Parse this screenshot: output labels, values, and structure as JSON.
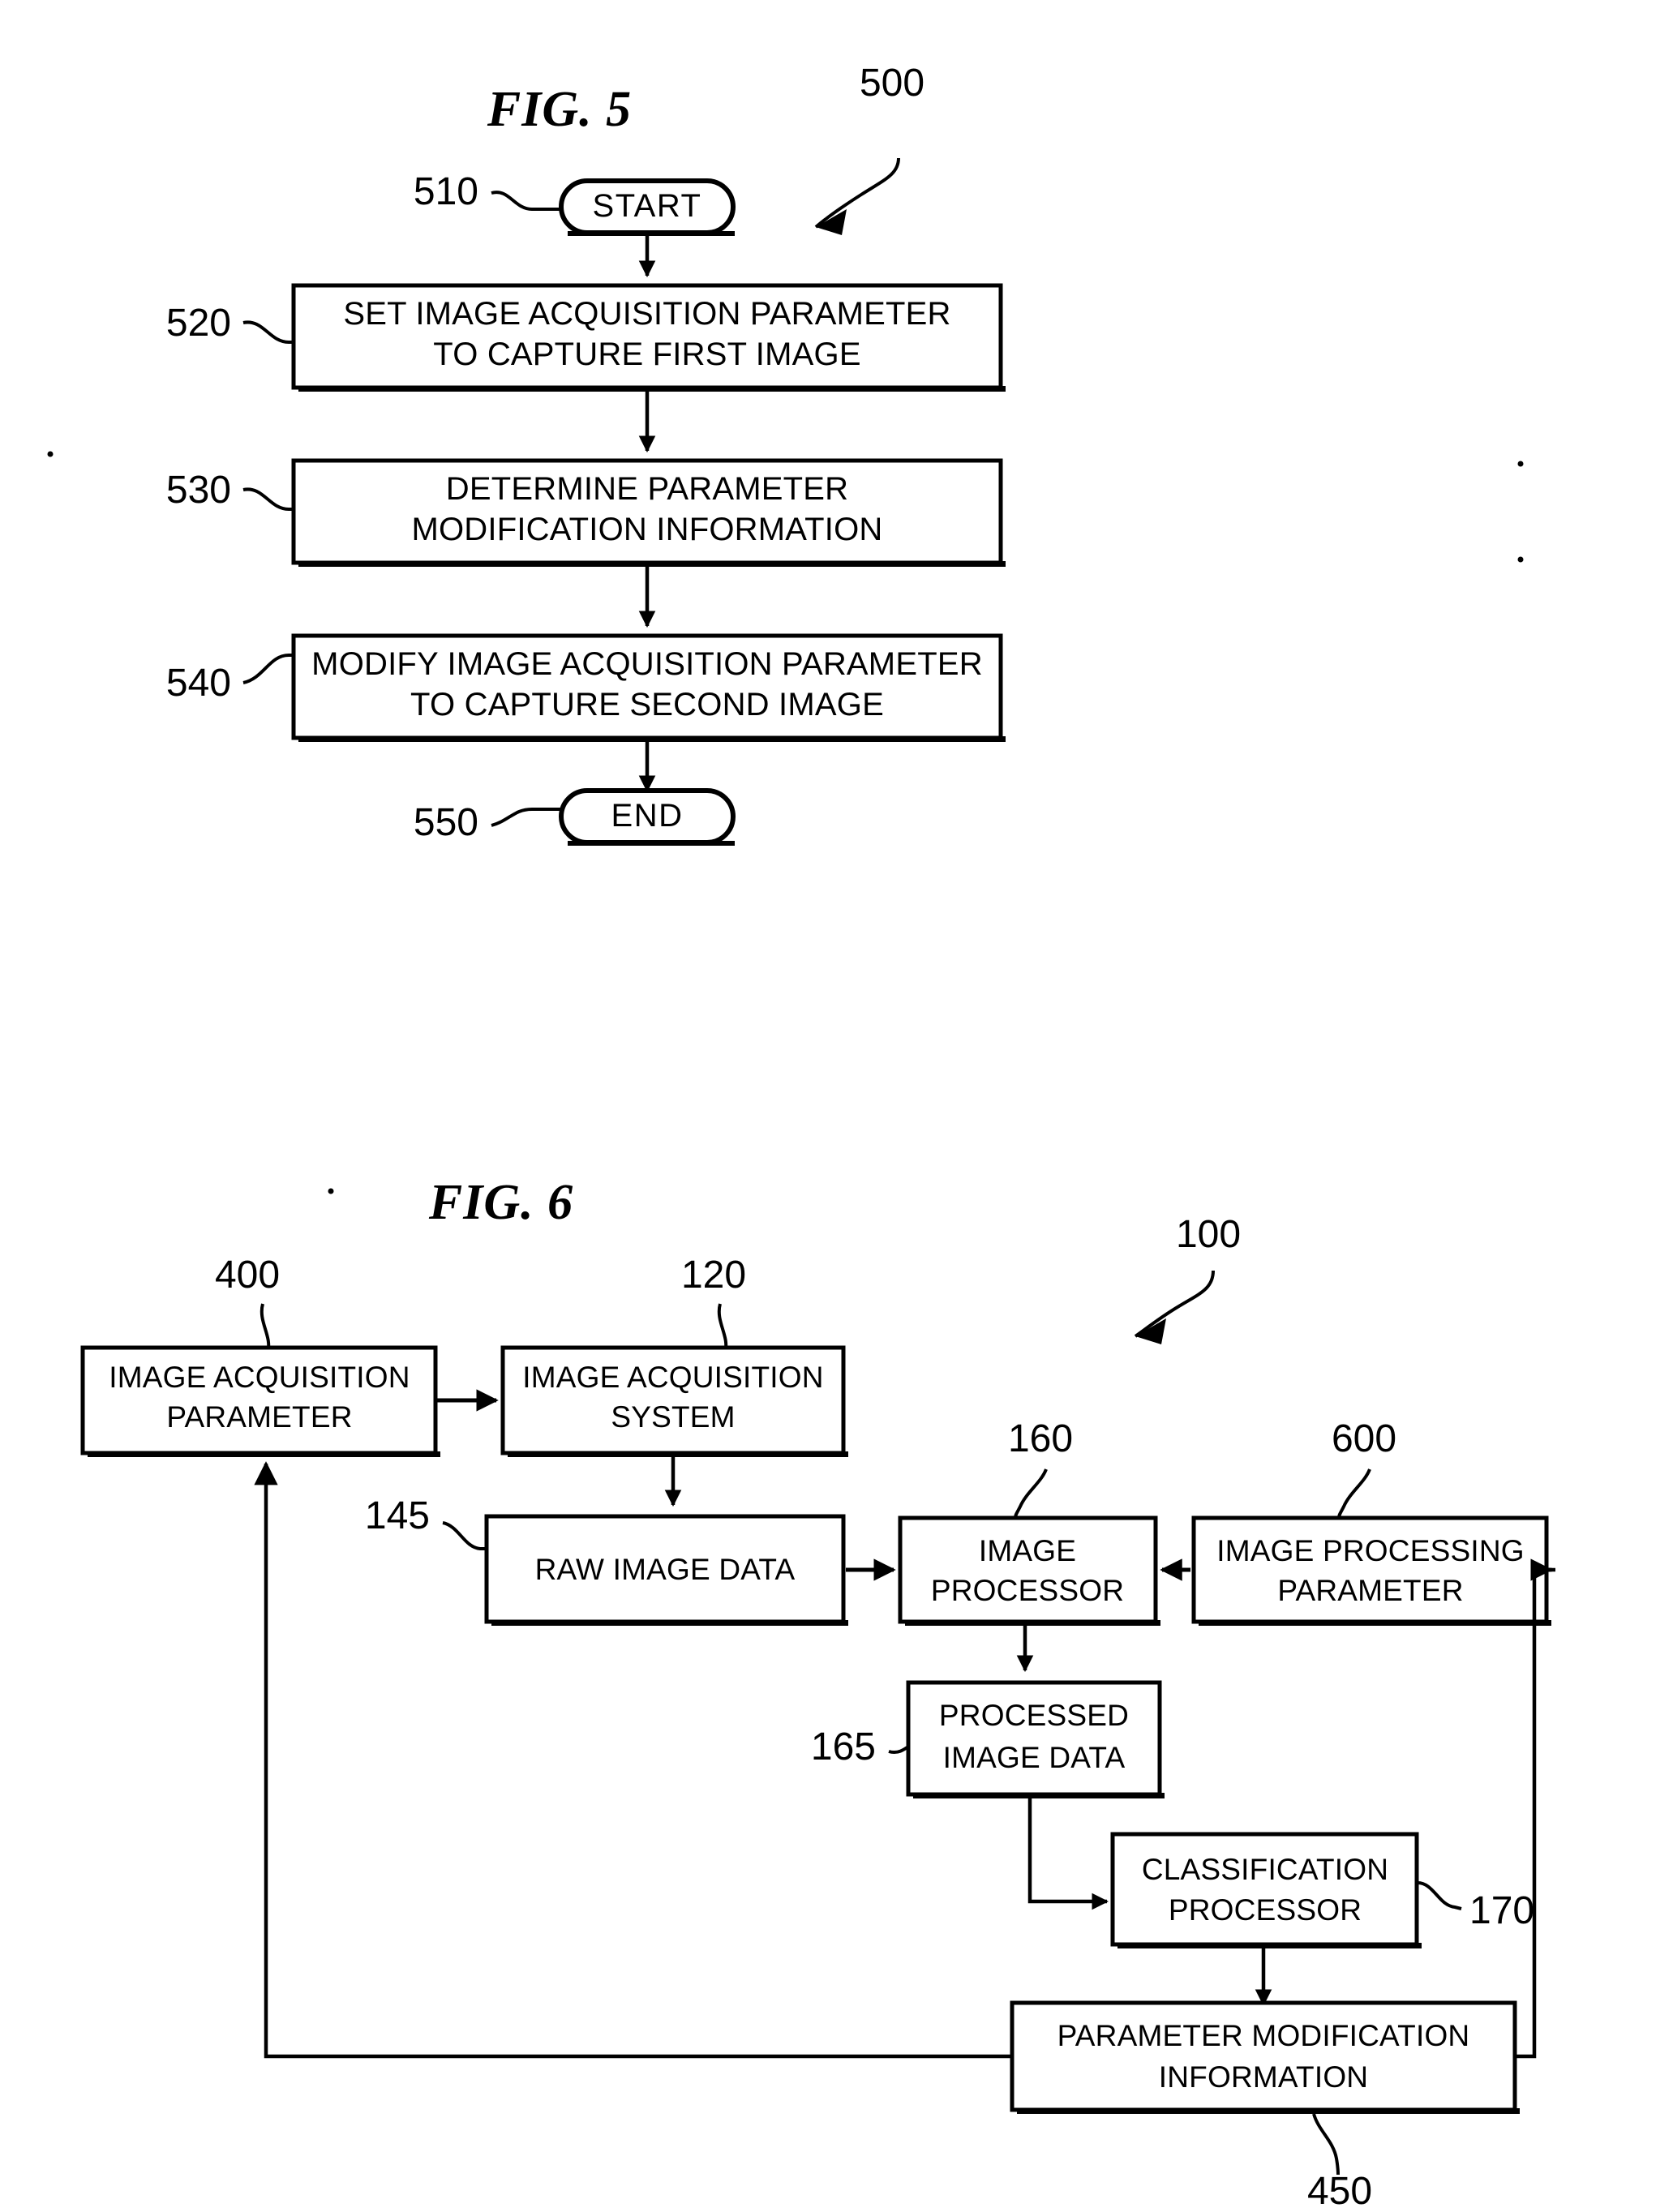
{
  "figure5": {
    "title": "FIG. 5",
    "diagram_ref": "500",
    "nodes": {
      "start": {
        "ref": "510",
        "label": "START"
      },
      "step_520": {
        "ref": "520",
        "line1": "SET IMAGE ACQUISITION PARAMETER",
        "line2": "TO CAPTURE FIRST IMAGE"
      },
      "step_530": {
        "ref": "530",
        "line1": "DETERMINE PARAMETER",
        "line2": "MODIFICATION INFORMATION"
      },
      "step_540": {
        "ref": "540",
        "line1": "MODIFY IMAGE ACQUISITION PARAMETER",
        "line2": "TO CAPTURE SECOND IMAGE"
      },
      "end": {
        "ref": "550",
        "label": "END"
      }
    }
  },
  "figure6": {
    "title": "FIG. 6",
    "diagram_ref": "100",
    "nodes": {
      "acq_param": {
        "ref": "400",
        "line1": "IMAGE ACQUISITION",
        "line2": "PARAMETER"
      },
      "acq_system": {
        "ref": "120",
        "line1": "IMAGE ACQUISITION",
        "line2": "SYSTEM"
      },
      "raw_data": {
        "ref": "145",
        "line1": "RAW IMAGE DATA",
        "line2": ""
      },
      "image_processor": {
        "ref": "160",
        "line1": "IMAGE",
        "line2": "PROCESSOR"
      },
      "processing_param": {
        "ref": "600",
        "line1": "IMAGE PROCESSING",
        "line2": "PARAMETER"
      },
      "processed_data": {
        "ref": "165",
        "line1": "PROCESSED",
        "line2": "IMAGE DATA"
      },
      "classification": {
        "ref": "170",
        "line1": "CLASSIFICATION",
        "line2": "PROCESSOR"
      },
      "param_mod_info": {
        "ref": "450",
        "line1": "PARAMETER MODIFICATION",
        "line2": "INFORMATION"
      }
    }
  },
  "colors": {
    "ink": "#000000",
    "paper": "#ffffff"
  }
}
